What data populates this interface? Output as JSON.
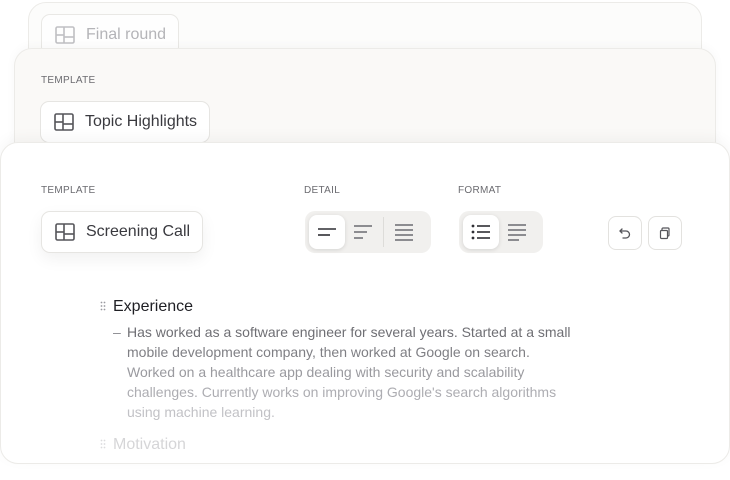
{
  "cards": {
    "back": {
      "template_name": "Final round"
    },
    "middle": {
      "template_label": "TEMPLATE",
      "template_name": "Topic Highlights"
    },
    "front": {
      "template_label": "TEMPLATE",
      "template_name": "Screening Call",
      "detail_label": "DETAIL",
      "format_label": "FORMAT",
      "detail_options": [
        "short",
        "medium",
        "long"
      ],
      "detail_selected": "short",
      "format_options": [
        "bullets",
        "paragraph"
      ],
      "format_selected": "bullets"
    }
  },
  "icons": {
    "template": "layout-template-icon",
    "undo": "undo-icon",
    "copy": "copy-icon",
    "drag": "drag-handle-icon"
  },
  "document": {
    "sections": [
      {
        "heading": "Experience",
        "bullet_lines": [
          "Has worked as a software engineer for several years. Started at a small",
          "mobile development company, then worked at Google on search.",
          "Worked on a healthcare app dealing with security and scalability",
          "challenges. Currently works on improving Google's search algorithms",
          "using machine learning."
        ]
      },
      {
        "heading": "Motivation"
      }
    ]
  },
  "colors": {
    "text_line_colors": [
      "#6f6f74",
      "#7f7f84",
      "#9a9a9f",
      "#adadb2",
      "#c2c2c6"
    ]
  }
}
